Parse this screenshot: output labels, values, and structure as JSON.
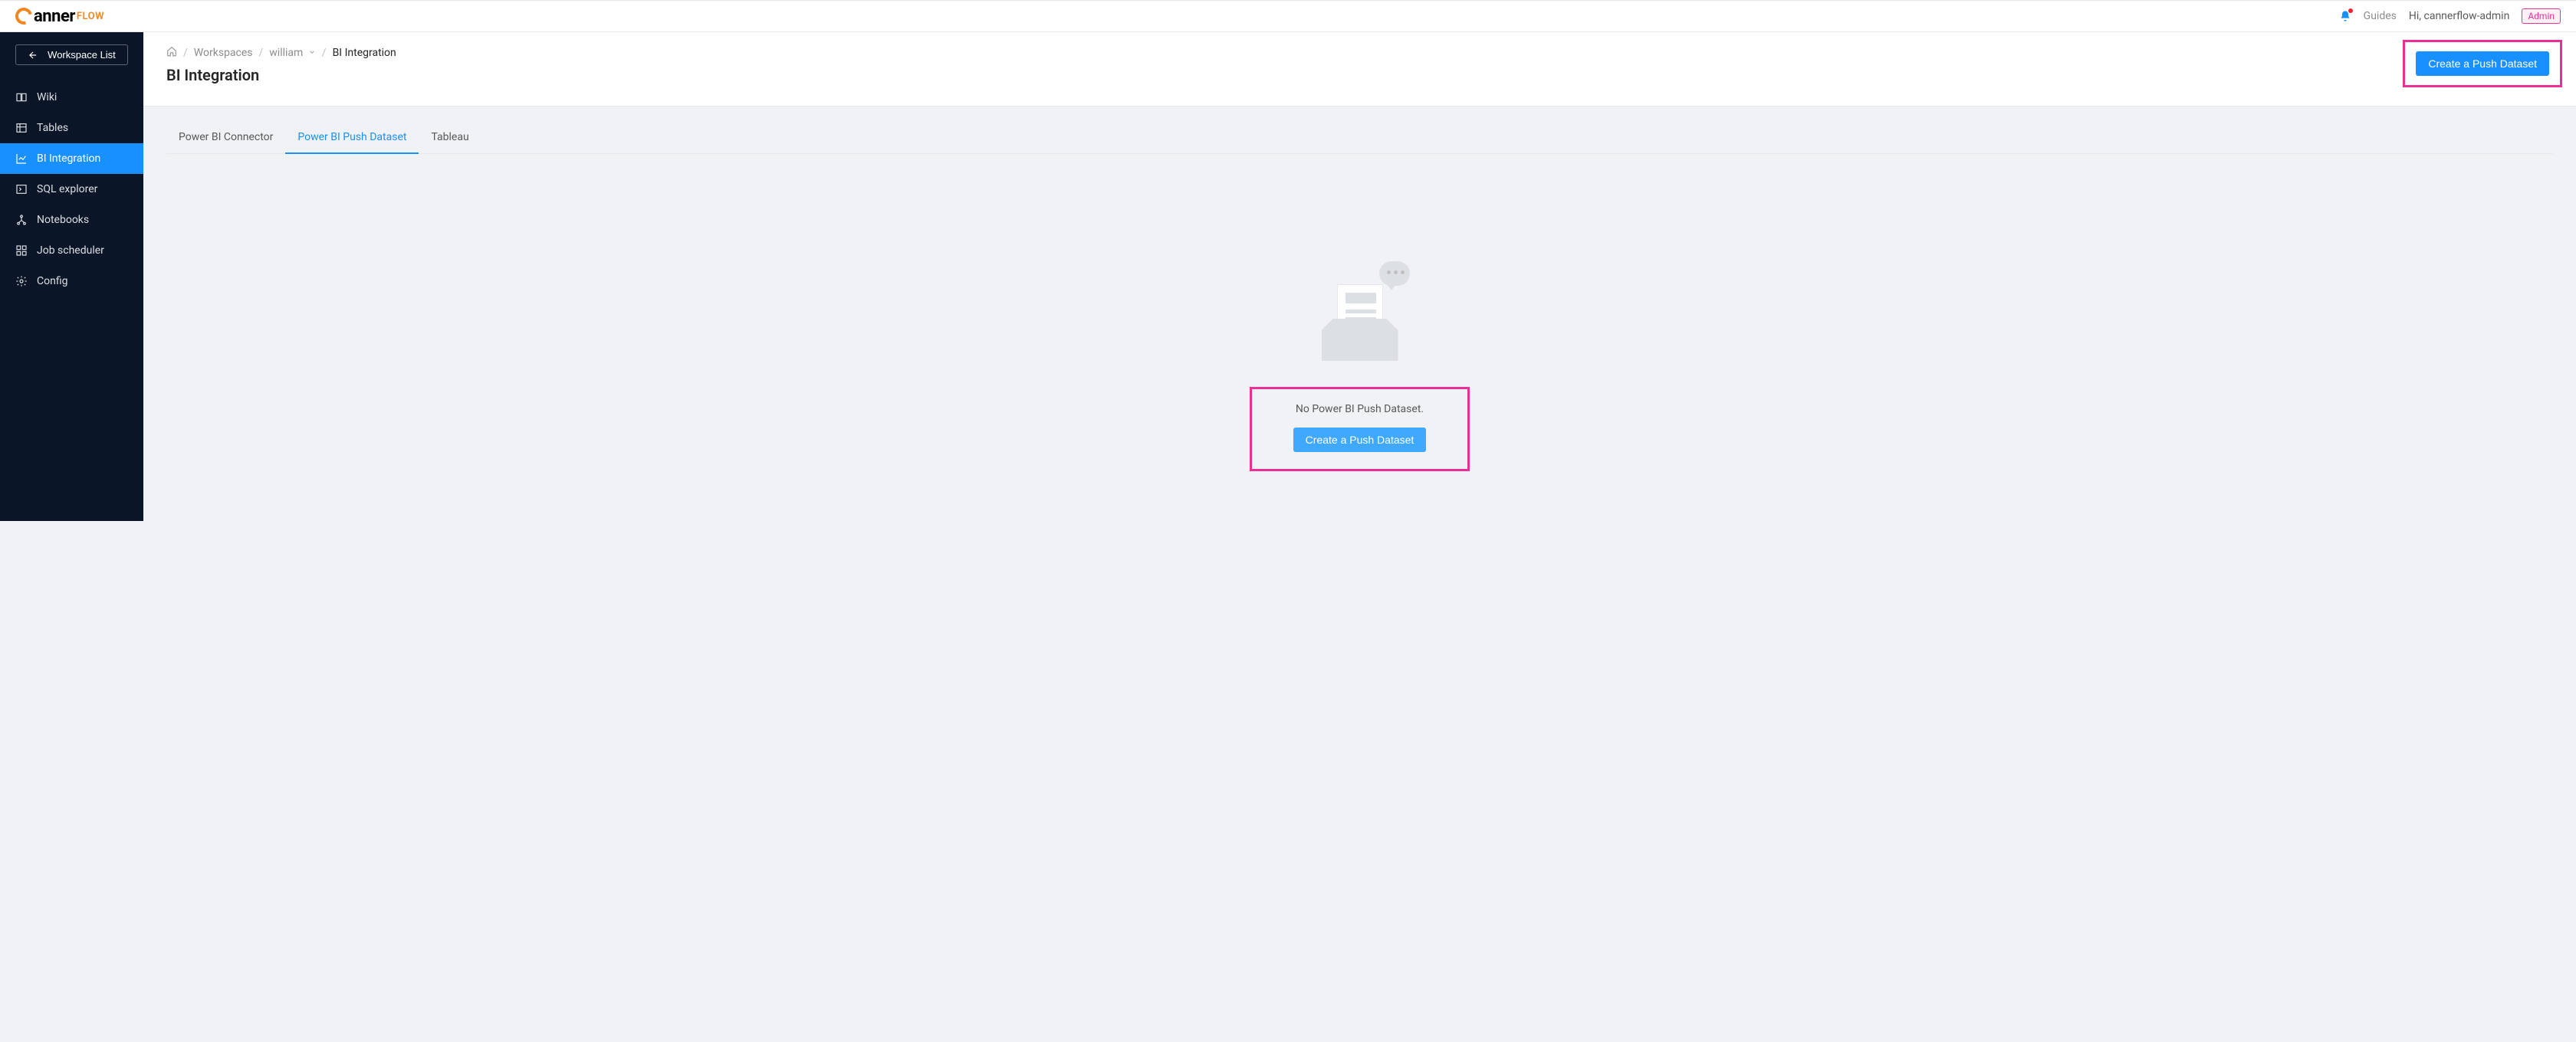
{
  "header": {
    "guides_label": "Guides",
    "greeting": "Hi, cannerflow-admin",
    "admin_badge": "Admin"
  },
  "sidebar": {
    "workspace_list_label": "Workspace List",
    "items": [
      {
        "label": "Wiki",
        "icon": "book-icon"
      },
      {
        "label": "Tables",
        "icon": "table-icon"
      },
      {
        "label": "BI Integration",
        "icon": "chart-line-icon"
      },
      {
        "label": "SQL explorer",
        "icon": "terminal-icon"
      },
      {
        "label": "Notebooks",
        "icon": "network-icon"
      },
      {
        "label": "Job scheduler",
        "icon": "grid-icon"
      },
      {
        "label": "Config",
        "icon": "gear-icon"
      }
    ]
  },
  "breadcrumb": {
    "workspaces": "Workspaces",
    "project": "william",
    "current": "BI Integration"
  },
  "page": {
    "title": "BI Integration",
    "create_button": "Create a Push Dataset"
  },
  "tabs": [
    {
      "label": "Power BI Connector"
    },
    {
      "label": "Power BI Push Dataset"
    },
    {
      "label": "Tableau"
    }
  ],
  "empty": {
    "message": "No Power BI Push Dataset.",
    "button": "Create a Push Dataset"
  }
}
